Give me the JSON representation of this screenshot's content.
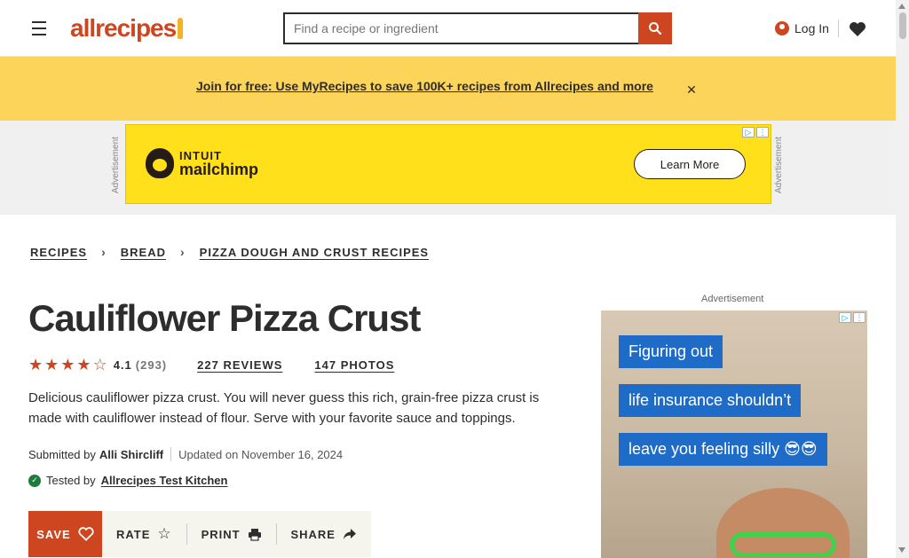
{
  "header": {
    "logo_text": "allrecipes",
    "search_placeholder": "Find a recipe or ingredient",
    "login_label": "Log In"
  },
  "promo": {
    "text": "Join for free: Use MyRecipes to save 100K+ recipes from Allrecipes and more",
    "close_glyph": "✕"
  },
  "ads": {
    "label": "Advertisement",
    "leader": {
      "brand_top": "INTUIT",
      "brand_bottom": "mailchimp",
      "cta": "Learn More"
    },
    "side": {
      "lines": [
        "Figuring out",
        "life insurance shouldn’t",
        "leave you feeling silly 😎😎"
      ]
    }
  },
  "breadcrumbs": [
    "RECIPES",
    "BREAD",
    "PIZZA DOUGH AND CRUST RECIPES"
  ],
  "recipe": {
    "title": "Cauliflower Pizza Crust",
    "rating": "4.1",
    "rating_count": "(293)",
    "reviews_label": "227 REVIEWS",
    "photos_label": "147 PHOTOS",
    "description": "Delicious cauliflower pizza crust. You will never guess this rich, grain-free pizza crust is made with cauliflower instead of flour. Serve with your favorite sauce and toppings.",
    "submitted_prefix": "Submitted by",
    "author": "Alli Shircliff",
    "updated": "Updated on November 16, 2024",
    "tested_prefix": "Tested by",
    "tester": "Allrecipes Test Kitchen"
  },
  "actions": {
    "save": "SAVE",
    "rate": "RATE",
    "print": "PRINT",
    "share": "SHARE"
  },
  "colors": {
    "brand": "#ce4620",
    "promo_bg": "#fcd459",
    "star": "#ce4620"
  }
}
